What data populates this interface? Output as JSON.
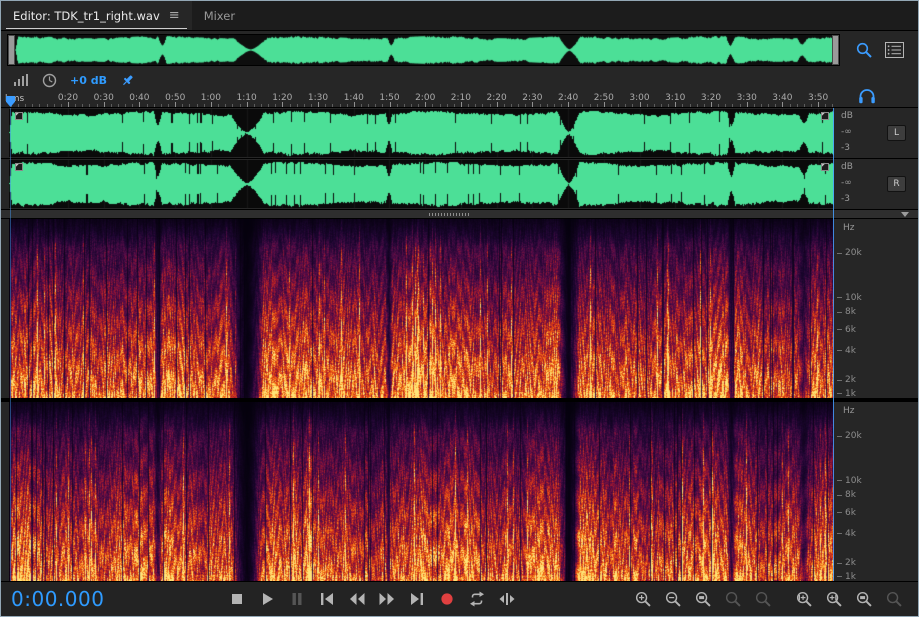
{
  "tabs": {
    "editor": "Editor: TDK_tr1_right.wav",
    "mixer": "Mixer"
  },
  "hud": {
    "gain": "+0 dB"
  },
  "ruler": {
    "unit": "hms",
    "labels": [
      "0:20",
      "0:30",
      "0:40",
      "0:50",
      "1:00",
      "1:10",
      "1:20",
      "1:30",
      "1:40",
      "1:50",
      "2:00",
      "2:10",
      "2:20",
      "2:30",
      "2:40",
      "2:50",
      "3:00",
      "3:10",
      "3:20",
      "3:30",
      "3:40",
      "3:50"
    ]
  },
  "waveform": {
    "scale_unit": "dB",
    "scale_marks": [
      "-∞",
      "-3"
    ],
    "channels": [
      {
        "label": "L"
      },
      {
        "label": "R"
      }
    ]
  },
  "spectrogram": {
    "scale_unit": "Hz",
    "ticks": [
      {
        "label": "20k",
        "pos": 0.19
      },
      {
        "label": "10k",
        "pos": 0.44
      },
      {
        "label": "8k",
        "pos": 0.52
      },
      {
        "label": "6k",
        "pos": 0.62
      },
      {
        "label": "4k",
        "pos": 0.735
      },
      {
        "label": "2k",
        "pos": 0.9
      },
      {
        "label": "1k",
        "pos": 0.975
      }
    ]
  },
  "transport": {
    "time": "0:00.000",
    "buttons": [
      {
        "name": "stop",
        "enabled": true
      },
      {
        "name": "play",
        "enabled": true
      },
      {
        "name": "pause",
        "enabled": false
      },
      {
        "name": "skip-to-start",
        "enabled": true
      },
      {
        "name": "rewind",
        "enabled": true
      },
      {
        "name": "fast-forward",
        "enabled": true
      },
      {
        "name": "skip-to-end",
        "enabled": true
      },
      {
        "name": "record",
        "enabled": true
      },
      {
        "name": "loop-playback",
        "enabled": true
      },
      {
        "name": "skip-selection",
        "enabled": true
      }
    ],
    "zoom_buttons": [
      {
        "name": "zoom-in",
        "type": "plus",
        "enabled": true
      },
      {
        "name": "zoom-out",
        "type": "minus",
        "enabled": true
      },
      {
        "name": "zoom-to-selection",
        "type": "box",
        "enabled": true
      },
      {
        "name": "zoom-out-full",
        "type": "plain",
        "enabled": false
      },
      {
        "name": "zoom-reset",
        "type": "plain",
        "enabled": false
      },
      {
        "name": "zoom-in-at-in-point",
        "type": "inpoint",
        "enabled": true
      },
      {
        "name": "zoom-in-at-out-point",
        "type": "outpoint",
        "enabled": true
      },
      {
        "name": "zoom-selection-time",
        "type": "box",
        "enabled": true
      },
      {
        "name": "zoom-full",
        "type": "plain",
        "enabled": false
      }
    ]
  },
  "icons": [
    "panel-menu-icon",
    "zoom-tool-icon",
    "panel-list-icon",
    "level-meter-icon",
    "clock-icon",
    "pin-icon",
    "headphones-icon",
    "playhead-marker",
    "collapse-arrow-icon",
    "overview-left-handle",
    "overview-right-handle"
  ],
  "colors": {
    "accent_blue": "#2f9bff",
    "wave_green": "#4cdf97",
    "record_red": "#e04040"
  }
}
